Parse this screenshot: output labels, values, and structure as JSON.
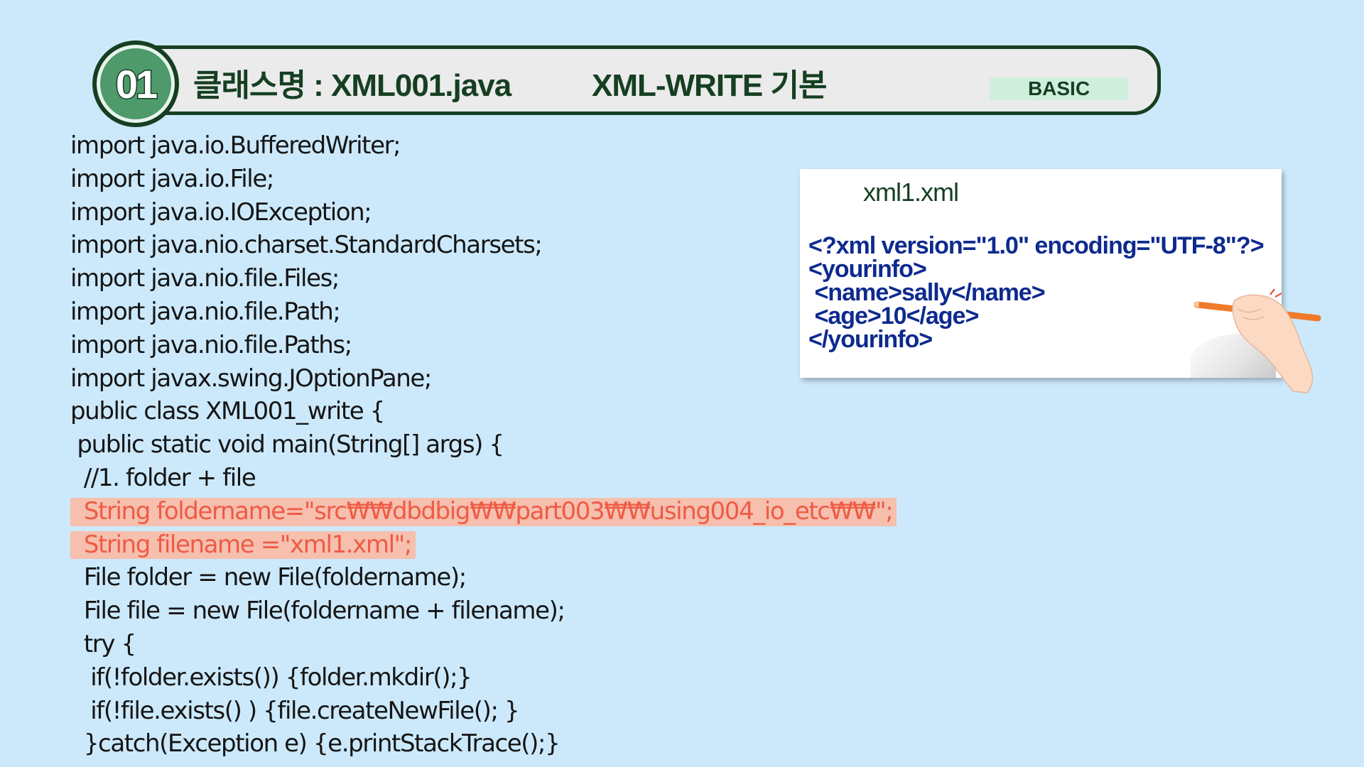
{
  "header": {
    "number": "01",
    "class_title": "클래스명 : XML001.java",
    "topic_title": "XML-WRITE 기본",
    "level": "BASIC"
  },
  "code_lines": [
    {
      "text": "import java.io.BufferedWriter;",
      "highlight": false
    },
    {
      "text": "import java.io.File;",
      "highlight": false
    },
    {
      "text": "import java.io.IOException;",
      "highlight": false
    },
    {
      "text": "import java.nio.charset.StandardCharsets;",
      "highlight": false
    },
    {
      "text": "import java.nio.file.Files;",
      "highlight": false
    },
    {
      "text": "import java.nio.file.Path;",
      "highlight": false
    },
    {
      "text": "import java.nio.file.Paths;",
      "highlight": false
    },
    {
      "text": "import javax.swing.JOptionPane;",
      "highlight": false
    },
    {
      "text": "public class XML001_write {",
      "highlight": false
    },
    {
      "text": " public static void main(String[] args) {",
      "highlight": false
    },
    {
      "text": "  //1. folder + file",
      "highlight": false
    },
    {
      "text": "  String foldername=\"src₩₩dbdbig₩₩part003₩₩using004_io_etc₩₩\";",
      "highlight": true
    },
    {
      "text": "  String filename =\"xml1.xml\";",
      "highlight": true
    },
    {
      "text": "  File folder = new File(foldername);",
      "highlight": false
    },
    {
      "text": "  File file = new File(foldername + filename);",
      "highlight": false
    },
    {
      "text": "  try {",
      "highlight": false
    },
    {
      "text": "   if(!folder.exists()) {folder.mkdir();}",
      "highlight": false
    },
    {
      "text": "   if(!file.exists() ) {file.createNewFile(); }",
      "highlight": false
    },
    {
      "text": "  }catch(Exception e) {e.printStackTrace();}",
      "highlight": false
    }
  ],
  "xml_preview": {
    "filename": "xml1.xml",
    "lines": [
      "<?xml version=\"1.0\" encoding=\"UTF-8\"?>",
      "<yourinfo>",
      " <name>sally</name>",
      " <age>10</age>",
      "</yourinfo>"
    ]
  },
  "colors": {
    "background": "#cce9fb",
    "header_border": "#163f22",
    "badge_fill": "#4e9a6b",
    "highlight_text": "#ee5b45",
    "highlight_bg": "#f6bfae",
    "xml_text": "#0e2a8f"
  },
  "icons": {
    "illustration": "hand-with-pencil-icon"
  }
}
